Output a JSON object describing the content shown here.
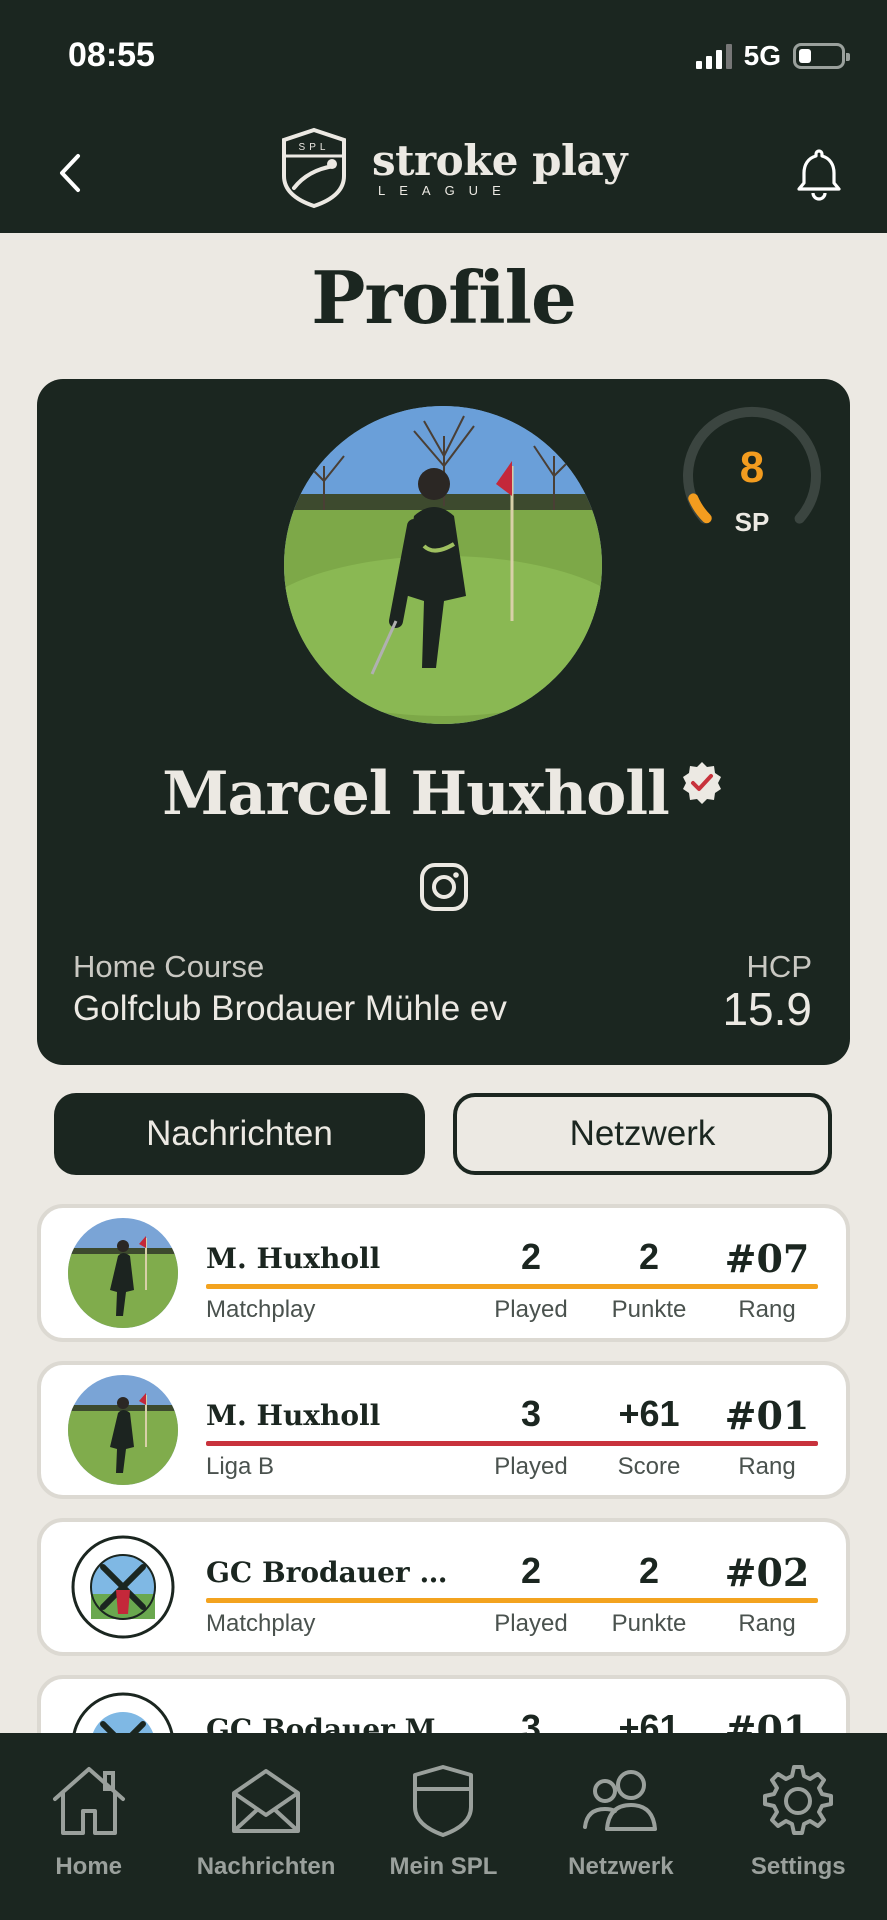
{
  "status": {
    "time": "08:55",
    "network": "5G"
  },
  "header": {
    "logo_main": "stroke play",
    "logo_sub": "LEAGUE",
    "logo_badge": "SPL"
  },
  "page": {
    "title": "Profile"
  },
  "profile": {
    "name": "Marcel Huxholl",
    "sp_value": "8",
    "sp_label": "SP",
    "sp_progress": 0.08,
    "home_course_label": "Home Course",
    "home_course": "Golfclub Brodauer Mühle ev",
    "hcp_label": "HCP",
    "hcp_value": "15.9"
  },
  "tabs": {
    "messages": "Nachrichten",
    "network": "Netzwerk"
  },
  "rows": [
    {
      "name": "M. Huxholl",
      "sub": "Matchplay",
      "line_color": "#f3a31f",
      "s1_val": "2",
      "s1_lbl": "Played",
      "s2_val": "2",
      "s2_lbl": "Punkte",
      "rank": "#07",
      "rank_lbl": "Rang"
    },
    {
      "name": "M. Huxholl",
      "sub": "Liga B",
      "line_color": "#c8323c",
      "s1_val": "3",
      "s1_lbl": "Played",
      "s2_val": "+61",
      "s2_lbl": "Score",
      "rank": "#01",
      "rank_lbl": "Rang"
    },
    {
      "name": "GC Brodauer Mühle ev",
      "sub": "Matchplay",
      "line_color": "#f3a31f",
      "s1_val": "2",
      "s1_lbl": "Played",
      "s2_val": "2",
      "s2_lbl": "Punkte",
      "rank": "#02",
      "rank_lbl": "Rang"
    },
    {
      "name": "GC Bodauer Mühle",
      "sub": "",
      "line_color": "#c8323c",
      "s1_val": "3",
      "s1_lbl": "",
      "s2_val": "+61",
      "s2_lbl": "",
      "rank": "#01",
      "rank_lbl": ""
    }
  ],
  "nav": [
    {
      "label": "Home",
      "icon": "home-icon"
    },
    {
      "label": "Nachrichten",
      "icon": "mail-icon"
    },
    {
      "label": "Mein SPL",
      "icon": "shield-icon"
    },
    {
      "label": "Netzwerk",
      "icon": "people-icon"
    },
    {
      "label": "Settings",
      "icon": "gear-icon"
    }
  ],
  "colors": {
    "dark": "#1b2620",
    "background": "#ece9e3",
    "accent_orange": "#f39c1f",
    "accent_red": "#c8323c"
  }
}
